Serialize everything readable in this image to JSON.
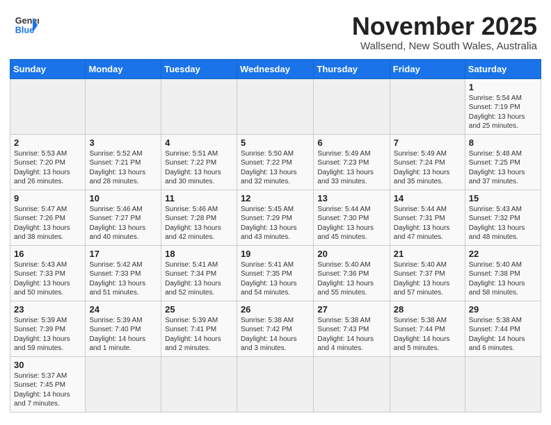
{
  "header": {
    "logo_line1": "General",
    "logo_line2": "Blue",
    "month_title": "November 2025",
    "location": "Wallsend, New South Wales, Australia"
  },
  "weekdays": [
    "Sunday",
    "Monday",
    "Tuesday",
    "Wednesday",
    "Thursday",
    "Friday",
    "Saturday"
  ],
  "weeks": [
    [
      {
        "day": "",
        "info": ""
      },
      {
        "day": "",
        "info": ""
      },
      {
        "day": "",
        "info": ""
      },
      {
        "day": "",
        "info": ""
      },
      {
        "day": "",
        "info": ""
      },
      {
        "day": "",
        "info": ""
      },
      {
        "day": "1",
        "info": "Sunrise: 5:54 AM\nSunset: 7:19 PM\nDaylight: 13 hours\nand 25 minutes."
      }
    ],
    [
      {
        "day": "2",
        "info": "Sunrise: 5:53 AM\nSunset: 7:20 PM\nDaylight: 13 hours\nand 26 minutes."
      },
      {
        "day": "3",
        "info": "Sunrise: 5:52 AM\nSunset: 7:21 PM\nDaylight: 13 hours\nand 28 minutes."
      },
      {
        "day": "4",
        "info": "Sunrise: 5:51 AM\nSunset: 7:22 PM\nDaylight: 13 hours\nand 30 minutes."
      },
      {
        "day": "5",
        "info": "Sunrise: 5:50 AM\nSunset: 7:22 PM\nDaylight: 13 hours\nand 32 minutes."
      },
      {
        "day": "6",
        "info": "Sunrise: 5:49 AM\nSunset: 7:23 PM\nDaylight: 13 hours\nand 33 minutes."
      },
      {
        "day": "7",
        "info": "Sunrise: 5:49 AM\nSunset: 7:24 PM\nDaylight: 13 hours\nand 35 minutes."
      },
      {
        "day": "8",
        "info": "Sunrise: 5:48 AM\nSunset: 7:25 PM\nDaylight: 13 hours\nand 37 minutes."
      }
    ],
    [
      {
        "day": "9",
        "info": "Sunrise: 5:47 AM\nSunset: 7:26 PM\nDaylight: 13 hours\nand 38 minutes."
      },
      {
        "day": "10",
        "info": "Sunrise: 5:46 AM\nSunset: 7:27 PM\nDaylight: 13 hours\nand 40 minutes."
      },
      {
        "day": "11",
        "info": "Sunrise: 5:46 AM\nSunset: 7:28 PM\nDaylight: 13 hours\nand 42 minutes."
      },
      {
        "day": "12",
        "info": "Sunrise: 5:45 AM\nSunset: 7:29 PM\nDaylight: 13 hours\nand 43 minutes."
      },
      {
        "day": "13",
        "info": "Sunrise: 5:44 AM\nSunset: 7:30 PM\nDaylight: 13 hours\nand 45 minutes."
      },
      {
        "day": "14",
        "info": "Sunrise: 5:44 AM\nSunset: 7:31 PM\nDaylight: 13 hours\nand 47 minutes."
      },
      {
        "day": "15",
        "info": "Sunrise: 5:43 AM\nSunset: 7:32 PM\nDaylight: 13 hours\nand 48 minutes."
      }
    ],
    [
      {
        "day": "16",
        "info": "Sunrise: 5:43 AM\nSunset: 7:33 PM\nDaylight: 13 hours\nand 50 minutes."
      },
      {
        "day": "17",
        "info": "Sunrise: 5:42 AM\nSunset: 7:33 PM\nDaylight: 13 hours\nand 51 minutes."
      },
      {
        "day": "18",
        "info": "Sunrise: 5:41 AM\nSunset: 7:34 PM\nDaylight: 13 hours\nand 52 minutes."
      },
      {
        "day": "19",
        "info": "Sunrise: 5:41 AM\nSunset: 7:35 PM\nDaylight: 13 hours\nand 54 minutes."
      },
      {
        "day": "20",
        "info": "Sunrise: 5:40 AM\nSunset: 7:36 PM\nDaylight: 13 hours\nand 55 minutes."
      },
      {
        "day": "21",
        "info": "Sunrise: 5:40 AM\nSunset: 7:37 PM\nDaylight: 13 hours\nand 57 minutes."
      },
      {
        "day": "22",
        "info": "Sunrise: 5:40 AM\nSunset: 7:38 PM\nDaylight: 13 hours\nand 58 minutes."
      }
    ],
    [
      {
        "day": "23",
        "info": "Sunrise: 5:39 AM\nSunset: 7:39 PM\nDaylight: 13 hours\nand 59 minutes."
      },
      {
        "day": "24",
        "info": "Sunrise: 5:39 AM\nSunset: 7:40 PM\nDaylight: 14 hours\nand 1 minute."
      },
      {
        "day": "25",
        "info": "Sunrise: 5:39 AM\nSunset: 7:41 PM\nDaylight: 14 hours\nand 2 minutes."
      },
      {
        "day": "26",
        "info": "Sunrise: 5:38 AM\nSunset: 7:42 PM\nDaylight: 14 hours\nand 3 minutes."
      },
      {
        "day": "27",
        "info": "Sunrise: 5:38 AM\nSunset: 7:43 PM\nDaylight: 14 hours\nand 4 minutes."
      },
      {
        "day": "28",
        "info": "Sunrise: 5:38 AM\nSunset: 7:44 PM\nDaylight: 14 hours\nand 5 minutes."
      },
      {
        "day": "29",
        "info": "Sunrise: 5:38 AM\nSunset: 7:44 PM\nDaylight: 14 hours\nand 6 minutes."
      }
    ],
    [
      {
        "day": "30",
        "info": "Sunrise: 5:37 AM\nSunset: 7:45 PM\nDaylight: 14 hours\nand 7 minutes."
      },
      {
        "day": "",
        "info": ""
      },
      {
        "day": "",
        "info": ""
      },
      {
        "day": "",
        "info": ""
      },
      {
        "day": "",
        "info": ""
      },
      {
        "day": "",
        "info": ""
      },
      {
        "day": "",
        "info": ""
      }
    ]
  ]
}
